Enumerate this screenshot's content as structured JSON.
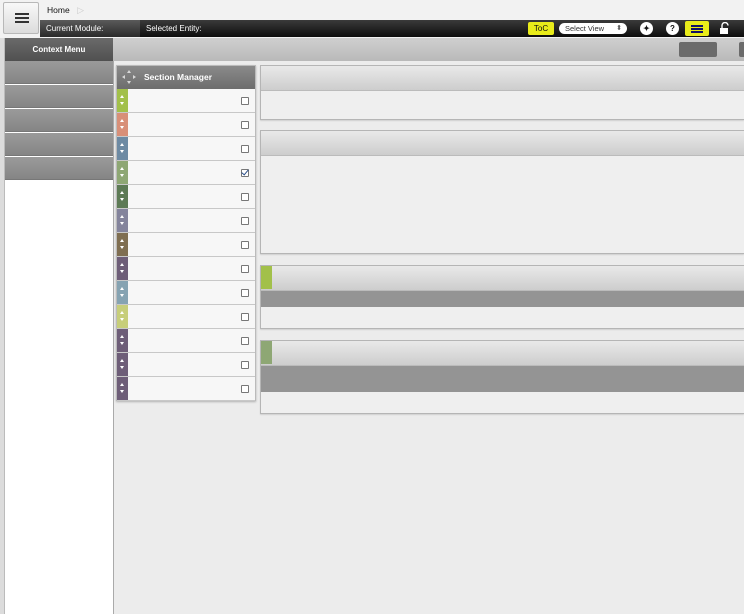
{
  "breadcrumb": {
    "home": "Home",
    "separator": "▷"
  },
  "infobar": {
    "current_module": "Current Module:",
    "selected_entity": "Selected Entity:",
    "toc": "ToC",
    "view_select": "Select View",
    "settings_glyph": "✦",
    "help_glyph": "?"
  },
  "context_menu": {
    "title": "Context Menu",
    "item_count": 5
  },
  "section_manager": {
    "title": "Section Manager",
    "rows": [
      {
        "color": "#a2c04a",
        "checked": false
      },
      {
        "color": "#d88f78",
        "checked": false
      },
      {
        "color": "#6d8aa3",
        "checked": false
      },
      {
        "color": "#8ea774",
        "checked": true
      },
      {
        "color": "#5d7a55",
        "checked": false
      },
      {
        "color": "#84849c",
        "checked": false
      },
      {
        "color": "#7f6e51",
        "checked": false
      },
      {
        "color": "#6e5e78",
        "checked": false
      },
      {
        "color": "#86a3b2",
        "checked": false
      },
      {
        "color": "#c7ce7a",
        "checked": false
      },
      {
        "color": "#6e5e78",
        "checked": false
      },
      {
        "color": "#6e5e78",
        "checked": false
      },
      {
        "color": "#6e5e78",
        "checked": false
      }
    ]
  },
  "panels": [
    {
      "accent": null,
      "has_dark_band": false
    },
    {
      "accent": null,
      "has_dark_band": false
    },
    {
      "accent": "#a2c04a",
      "has_dark_band": true
    },
    {
      "accent": "#8ea774",
      "has_dark_band": true
    }
  ],
  "colors": {
    "highlight": "#e9ec1a",
    "infobar": "#111111",
    "context_menu": "#8f8f8f"
  }
}
